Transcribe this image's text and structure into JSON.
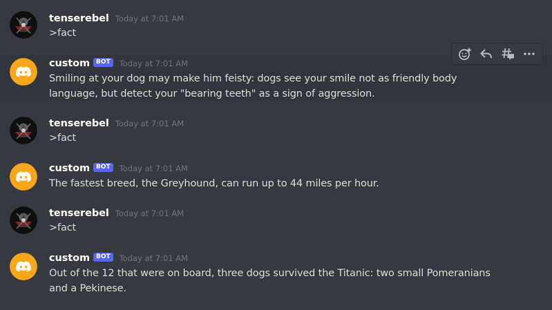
{
  "colors": {
    "background": "#36393f",
    "hover_background": "#32353b",
    "bot_badge": "#5865f2",
    "bot_avatar": "#faa61a",
    "username": "#ffffff",
    "text": "#dcddde",
    "timestamp": "#72767d"
  },
  "messages": [
    {
      "author": "tenserebel",
      "is_bot": false,
      "timestamp": "Today at 7:01 AM",
      "text": ">fact"
    },
    {
      "author": "custom",
      "is_bot": true,
      "badge": "BOT",
      "timestamp": "Today at 7:01 AM",
      "text": "Smiling at your dog may make him feisty: dogs see your smile not as friendly body language, but detect your \"bearing teeth\" as a sign of aggression."
    },
    {
      "author": "tenserebel",
      "is_bot": false,
      "timestamp": "Today at 7:01 AM",
      "text": ">fact"
    },
    {
      "author": "custom",
      "is_bot": true,
      "badge": "BOT",
      "timestamp": "Today at 7:01 AM",
      "text": "The fastest breed, the Greyhound, can run up to 44 miles per hour."
    },
    {
      "author": "tenserebel",
      "is_bot": false,
      "timestamp": "Today at 7:01 AM",
      "text": ">fact"
    },
    {
      "author": "custom",
      "is_bot": true,
      "badge": "BOT",
      "timestamp": "Today at 7:01 AM",
      "text": "Out of the 12 that were on board, three dogs survived the Titanic: two small Pomeranians and a Pekinese."
    }
  ],
  "toolbar": {
    "icons": [
      "add-reaction-icon",
      "reply-icon",
      "create-thread-icon",
      "more-icon"
    ]
  }
}
